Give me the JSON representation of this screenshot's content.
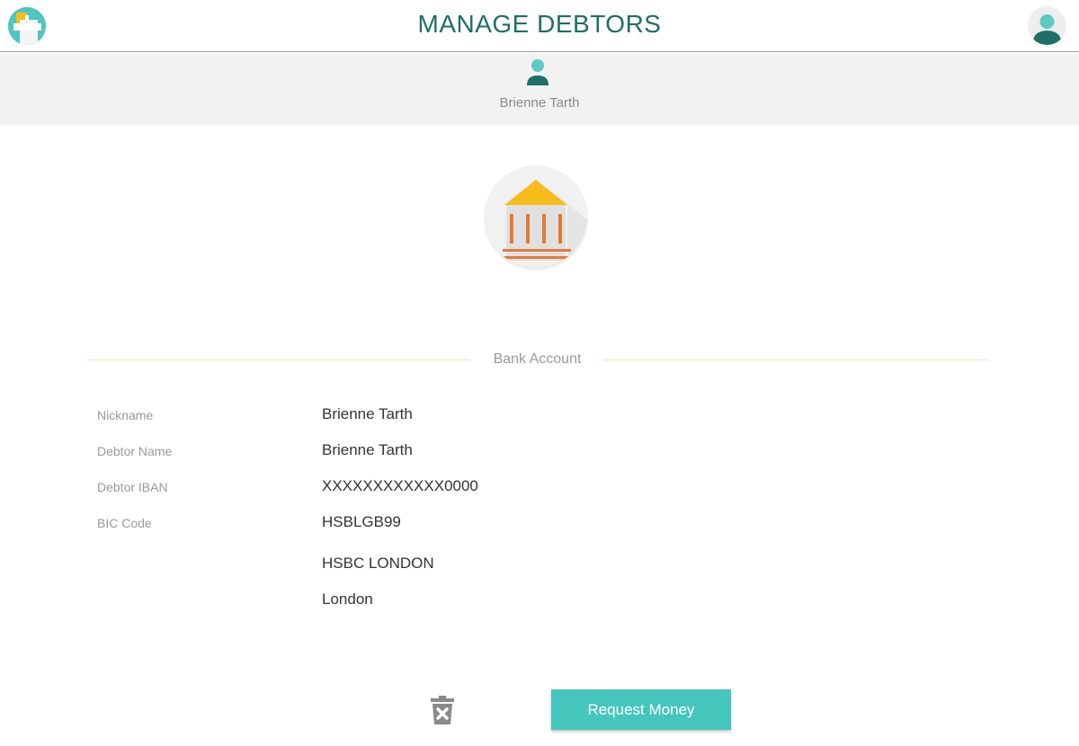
{
  "header": {
    "title": "MANAGE DEBTORS",
    "logo_icon": "app-logo-icon",
    "profile_icon": "user-profile-icon"
  },
  "debtor": {
    "name": "Brienne Tarth",
    "avatar_icon": "user-avatar-icon"
  },
  "account": {
    "type_icon": "bank-icon",
    "section_title": "Bank Account",
    "fields": [
      {
        "label": "Nickname",
        "value": "Brienne Tarth"
      },
      {
        "label": "Debtor Name",
        "value": "Brienne Tarth"
      },
      {
        "label": "Debtor IBAN",
        "value": "XXXXXXXXXXXX0000"
      },
      {
        "label": "BIC Code",
        "value": "HSBLGB99"
      }
    ],
    "bank_name": "HSBC LONDON",
    "bank_city": "London"
  },
  "actions": {
    "delete_icon": "trash-delete-icon",
    "request_label": "Request Money"
  },
  "colors": {
    "accent": "#45c6bd",
    "title": "#1f6e6a",
    "bank_roof": "#f6bc1b",
    "bank_columns": "#e27b39"
  }
}
